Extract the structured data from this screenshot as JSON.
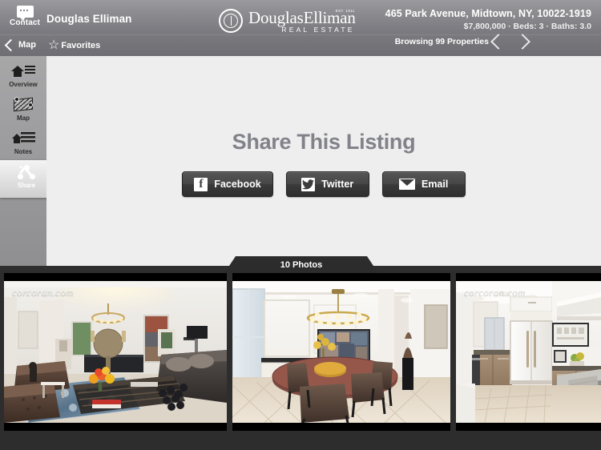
{
  "header": {
    "contact_label": "Contact",
    "contact_icon": "speech-bubble-icon",
    "brand_name": "Douglas Elliman",
    "logo": {
      "title": "DouglasElliman",
      "est": "EST. 1911",
      "subtitle": "REAL ESTATE",
      "mark": "de-monogram-icon"
    },
    "address": "465 Park Avenue, Midtown, NY, 10022-1919",
    "price_line": "$7,800,000 · Beds: 3 · Baths: 3.0",
    "browsing": "Browsing 99 Properties",
    "prev_icon": "chevron-left-icon",
    "next_icon": "chevron-right-icon",
    "back_label": "Map",
    "back_icon": "chevron-left-icon",
    "favorites_label": "Favorites",
    "favorites_icon": "star-outline-icon"
  },
  "sidebar": {
    "items": [
      {
        "label": "Overview",
        "icon": "house-list-icon",
        "active": false
      },
      {
        "label": "Map",
        "icon": "map-pins-icon",
        "active": false
      },
      {
        "label": "Notes",
        "icon": "house-notes-icon",
        "active": false
      },
      {
        "label": "Share",
        "icon": "share-nodes-icon",
        "active": true
      }
    ]
  },
  "main": {
    "title": "Share This Listing",
    "buttons": [
      {
        "label": "Facebook",
        "icon": "facebook-icon",
        "glyph": "f"
      },
      {
        "label": "Twitter",
        "icon": "twitter-bird-icon"
      },
      {
        "label": "Email",
        "icon": "envelope-icon"
      }
    ]
  },
  "photos": {
    "tab_label": "10 Photos",
    "watermark": "corcoran.com",
    "thumbnails": [
      {
        "name": "living-room-photo",
        "watermark": "corcoran.com"
      },
      {
        "name": "dining-room-photo",
        "watermark": "corcoran.com"
      },
      {
        "name": "kitchen-photo",
        "watermark": "corcoran.com"
      }
    ]
  },
  "colors": {
    "header_top": "#9a9a9e",
    "header_bottom": "#6e6e73",
    "panel_bg": "#eeeeee",
    "title_gray": "#82828a",
    "button_dark": "#3a3a3a",
    "strip_bg": "#2d2d2d"
  }
}
